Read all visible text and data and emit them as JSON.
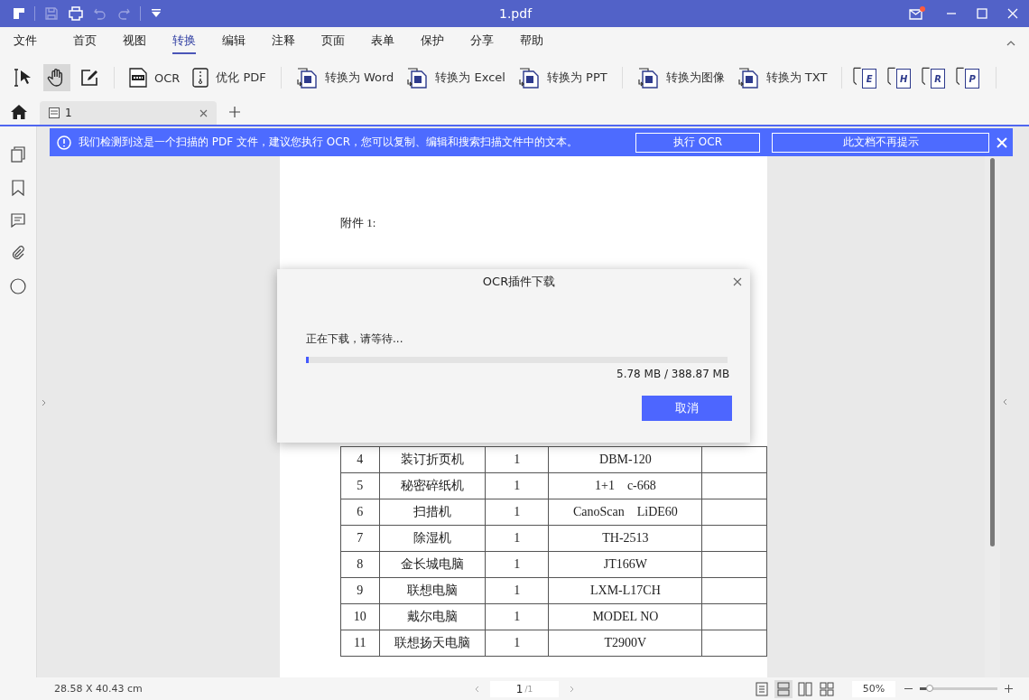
{
  "window": {
    "title": "1.pdf"
  },
  "menu": [
    {
      "label": "文件",
      "selected": false
    },
    {
      "label": "首页",
      "selected": false
    },
    {
      "label": "视图",
      "selected": false
    },
    {
      "label": "转换",
      "selected": true
    },
    {
      "label": "编辑",
      "selected": false
    },
    {
      "label": "注释",
      "selected": false
    },
    {
      "label": "页面",
      "selected": false
    },
    {
      "label": "表单",
      "selected": false
    },
    {
      "label": "保护",
      "selected": false
    },
    {
      "label": "分享",
      "selected": false
    },
    {
      "label": "帮助",
      "selected": false
    }
  ],
  "tools": [
    {
      "kind": "text-select",
      "selected": false
    },
    {
      "kind": "hand",
      "selected": true
    },
    {
      "kind": "edit",
      "selected": false
    }
  ],
  "actions": [
    {
      "kind": "ocr",
      "label": "OCR"
    },
    {
      "kind": "optimize",
      "label": "优化 PDF"
    },
    {
      "kind": "word",
      "label": "转换为 Word"
    },
    {
      "kind": "excel",
      "label": "转换为 Excel"
    },
    {
      "kind": "ppt",
      "label": "转换为 PPT"
    },
    {
      "kind": "image",
      "label": "转换为图像"
    },
    {
      "kind": "txt",
      "label": "转换为 TXT"
    }
  ],
  "format_buttons": [
    {
      "letter": "E"
    },
    {
      "letter": "H"
    },
    {
      "letter": "R"
    },
    {
      "letter": "P"
    }
  ],
  "tabs": [
    {
      "label": "1",
      "selected": true
    }
  ],
  "notice": {
    "text": "我们检测到这是一个扫描的 PDF 文件，建议您执行 OCR，您可以复制、编辑和搜索扫描文件中的文本。",
    "buttons": [
      "执行 OCR",
      "此文档不再提示"
    ]
  },
  "document": {
    "caption": "附件 1:",
    "rows": [
      {
        "no": "4",
        "name": "装订折页机",
        "qty": "1",
        "model": "DBM-120"
      },
      {
        "no": "5",
        "name": "秘密碎纸机",
        "qty": "1",
        "model": "1+1　c-668"
      },
      {
        "no": "6",
        "name": "扫措机",
        "qty": "1",
        "model": "CanoScan　LiDE60"
      },
      {
        "no": "7",
        "name": "除湿机",
        "qty": "1",
        "model": "TH-2513"
      },
      {
        "no": "8",
        "name": "金长城电脑",
        "qty": "1",
        "model": "JT166W"
      },
      {
        "no": "9",
        "name": "联想电脑",
        "qty": "1",
        "model": "LXM-L17CH"
      },
      {
        "no": "10",
        "name": "戴尔电脑",
        "qty": "1",
        "model": "MODEL NO"
      },
      {
        "no": "11",
        "name": "联想扬天电脑",
        "qty": "1",
        "model": "T2900V"
      }
    ]
  },
  "dialog": {
    "title": "OCR插件下载",
    "message": "正在下载，请等待...",
    "progress": {
      "level": 0.006
    },
    "size": "5.78 MB / 388.87 MB",
    "button": "取消"
  },
  "status": {
    "dimensions": "28.58 X 40.43 cm",
    "page": "1",
    "page_total": "/1",
    "zoom": "50%",
    "zoom_slider": {
      "level": 0.13
    },
    "views": [
      {
        "kind": "single",
        "selected": false
      },
      {
        "kind": "continuous",
        "selected": true
      },
      {
        "kind": "double",
        "selected": false
      },
      {
        "kind": "double-continuous",
        "selected": false
      }
    ]
  }
}
